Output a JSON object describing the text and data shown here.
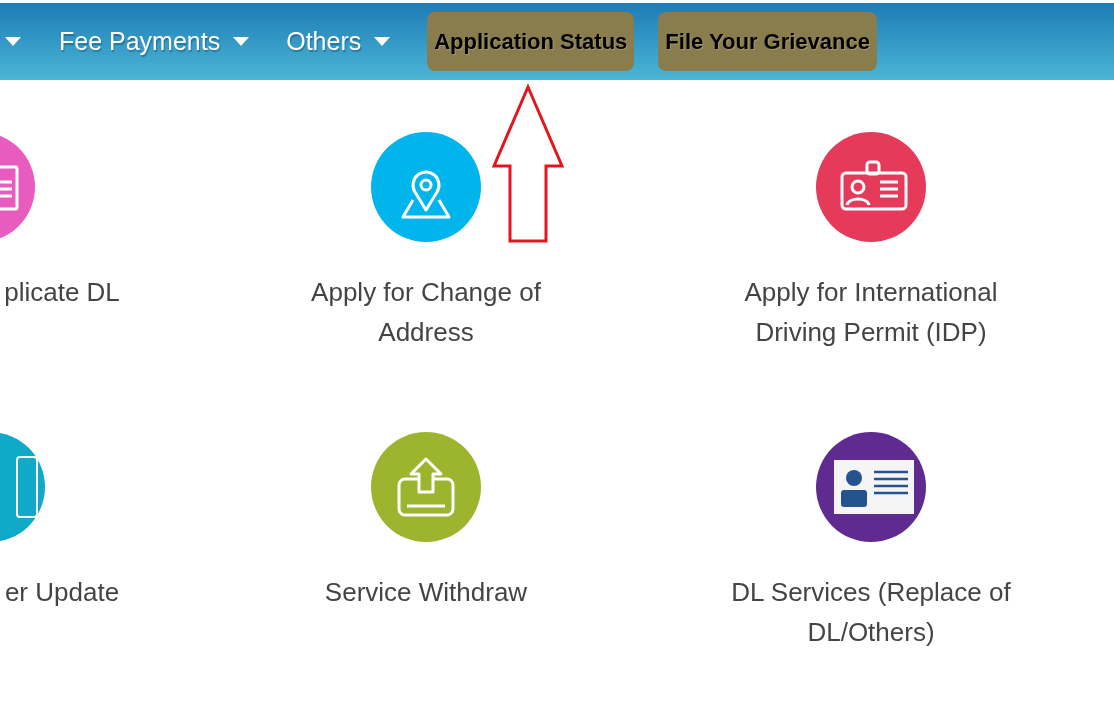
{
  "nav": {
    "menus": [
      {
        "kind": "cut"
      },
      {
        "kind": "menu",
        "label": "Fee Payments"
      },
      {
        "kind": "menu",
        "label": "Others"
      }
    ],
    "buttons": [
      "Application Status",
      "File Your Grievance"
    ]
  },
  "services": [
    {
      "kind": "document",
      "color": "#e95cbf",
      "label": "plicate DL"
    },
    {
      "kind": "map-pin",
      "color": "#00b4ec",
      "label": "Apply for Change of Address"
    },
    {
      "kind": "id-badge",
      "color": "#e53a5a",
      "label": "Apply for International Driving Permit (IDP)"
    },
    {
      "kind": "phone",
      "color": "#10a9c8",
      "label": "er Update"
    },
    {
      "kind": "upload",
      "color": "#9db42e",
      "label": "Service Withdraw"
    },
    {
      "kind": "id-card",
      "color": "#5f2b91",
      "label": "DL Services (Replace of DL/Others)"
    }
  ]
}
